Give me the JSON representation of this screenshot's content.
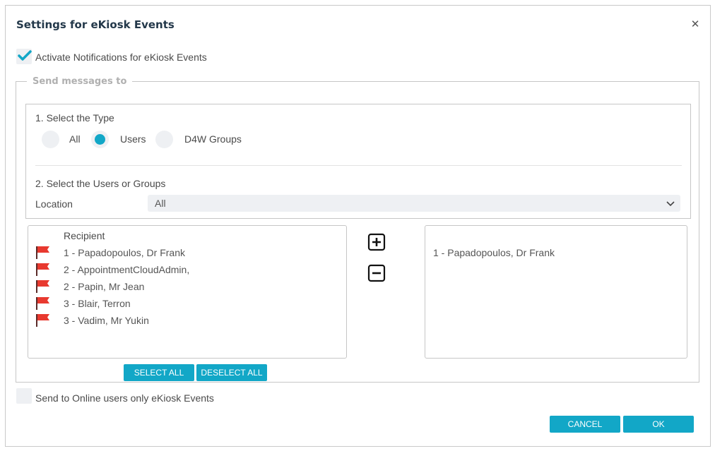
{
  "dialog": {
    "title": "Settings for eKiosk Events",
    "close_glyph": "✕"
  },
  "activate": {
    "label": "Activate Notifications for eKiosk Events",
    "checked": true
  },
  "send_to": {
    "legend": "Send messages to",
    "type_section": {
      "heading": "1. Select the Type",
      "options": [
        {
          "label": "All",
          "selected": false
        },
        {
          "label": "Users",
          "selected": true
        },
        {
          "label": "D4W Groups",
          "selected": false
        }
      ]
    },
    "users_section": {
      "heading": "2. Select the Users or Groups",
      "location_label": "Location",
      "location_value": "All"
    },
    "recipients": {
      "header": "Recipient",
      "items": [
        "1 - Papadopoulos, Dr Frank",
        "2 - AppointmentCloudAdmin,",
        "2 - Papin, Mr Jean",
        "3 - Blair, Terron",
        "3 - Vadim, Mr  Yukin"
      ],
      "flag_color": "#e8392f"
    },
    "selected": {
      "items": [
        "1 - Papadopoulos, Dr Frank"
      ]
    },
    "select_all_label": "SELECT ALL",
    "deselect_all_label": "DESELECT ALL"
  },
  "online_only": {
    "label": "Send to Online users only eKiosk Events",
    "checked": false
  },
  "footer": {
    "cancel_label": "CANCEL",
    "ok_label": "OK"
  },
  "colors": {
    "accent": "#12a7c7",
    "title": "#23384a"
  },
  "icons": {
    "add": "plus-square-icon",
    "remove": "minus-square-icon",
    "close": "close-icon",
    "check": "checkmark-icon",
    "dropdown": "chevron-down-icon",
    "flag": "flag-icon"
  }
}
